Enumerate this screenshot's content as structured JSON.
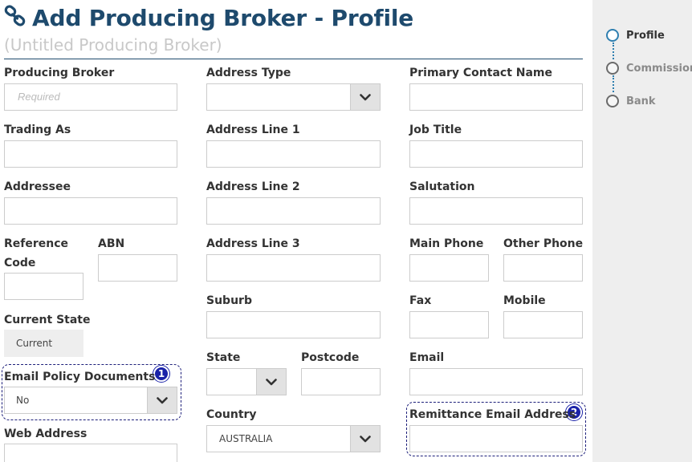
{
  "header": {
    "title": "Add Producing Broker - Profile",
    "subtitle": "(Untitled Producing Broker)",
    "icon": "link-icon",
    "accent_color": "#1e4a6d"
  },
  "form": {
    "producing_broker": {
      "label": "Producing Broker",
      "placeholder": "Required"
    },
    "trading_as": {
      "label": "Trading As"
    },
    "addressee": {
      "label": "Addressee"
    },
    "reference_code": {
      "label_line1": "Reference",
      "label_line2": "Code"
    },
    "abn": {
      "label": "ABN"
    },
    "current_state": {
      "label": "Current State",
      "value": "Current"
    },
    "email_policy_documents": {
      "label": "Email Policy Documents",
      "value": "No"
    },
    "web_address": {
      "label": "Web Address"
    },
    "address_type": {
      "label": "Address Type",
      "value": ""
    },
    "address_line_1": {
      "label": "Address Line 1"
    },
    "address_line_2": {
      "label": "Address Line 2"
    },
    "address_line_3": {
      "label": "Address Line 3"
    },
    "suburb": {
      "label": "Suburb"
    },
    "state": {
      "label": "State",
      "value": ""
    },
    "postcode": {
      "label": "Postcode"
    },
    "country": {
      "label": "Country",
      "value": "AUSTRALIA"
    },
    "primary_contact_name": {
      "label": "Primary Contact Name"
    },
    "job_title": {
      "label": "Job Title"
    },
    "salutation": {
      "label": "Salutation"
    },
    "main_phone": {
      "label": "Main Phone"
    },
    "other_phone": {
      "label": "Other Phone"
    },
    "fax": {
      "label": "Fax"
    },
    "mobile": {
      "label": "Mobile"
    },
    "email": {
      "label": "Email"
    },
    "remittance_email_address": {
      "label": "Remittance Email Address"
    }
  },
  "annotations": {
    "badge_1": "1",
    "badge_2": "2",
    "badge_color": "#1a22a8"
  },
  "steps": [
    {
      "label": "Profile",
      "active": true
    },
    {
      "label": "Commission",
      "active": false
    },
    {
      "label": "Bank",
      "active": false
    }
  ]
}
